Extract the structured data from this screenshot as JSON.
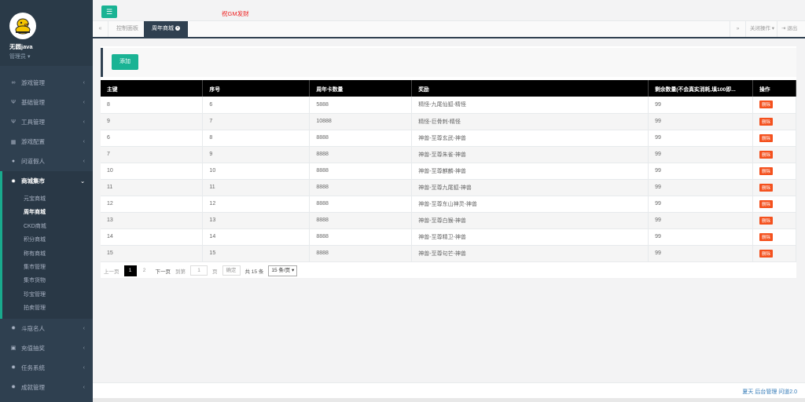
{
  "profile": {
    "name": "无圆java",
    "role": "管理员 ▾"
  },
  "sidebar": {
    "items": [
      {
        "icon": "gamepad-icon",
        "glyph": "∞",
        "label": "游戏管理"
      },
      {
        "icon": "cutlery-icon",
        "glyph": "Ψ",
        "label": "基础管理"
      },
      {
        "icon": "cutlery-icon",
        "glyph": "Ψ",
        "label": "工具管理"
      },
      {
        "icon": "table-icon",
        "glyph": "▦",
        "label": "游戏配置"
      },
      {
        "icon": "user-icon",
        "glyph": "●",
        "label": "问道假人"
      },
      {
        "icon": "gear-icon",
        "glyph": "✹",
        "label": "商城集市"
      }
    ],
    "submenu": [
      "元宝商城",
      "周年商城",
      "CKD商城",
      "积分商城",
      "称有商城",
      "集市管理",
      "集市货物",
      "珍宝管理",
      "拍卖管理"
    ],
    "items_after": [
      {
        "icon": "gear-icon",
        "glyph": "✹",
        "label": "斗寇名人"
      },
      {
        "icon": "table-icon",
        "glyph": "▣",
        "label": "充值抽奖"
      },
      {
        "icon": "gear-icon",
        "glyph": "✹",
        "label": "任务系统"
      },
      {
        "icon": "gear-icon",
        "glyph": "✹",
        "label": "成就管理"
      }
    ]
  },
  "topbar": {
    "marquee": "祝GM发财"
  },
  "tabs": {
    "items": [
      "控制面板",
      "周年商城"
    ],
    "right": {
      "close_ops": "关闭操作 ▾",
      "logout": "⇥ 退出"
    }
  },
  "toolbar": {
    "add_label": "添加"
  },
  "table": {
    "headers": [
      "主键",
      "序号",
      "周年卡数量",
      "奖励",
      "剩余数量(不会真实消耗,填100即...",
      "操作"
    ],
    "rows": [
      [
        "8",
        "6",
        "5888",
        "精怪-九尾仙狐-精怪",
        "99",
        "删除"
      ],
      [
        "9",
        "7",
        "10888",
        "精怪-巨骨刺-精怪",
        "99",
        "删除"
      ],
      [
        "6",
        "8",
        "8888",
        "神兽-至尊玄武-神兽",
        "99",
        "删除"
      ],
      [
        "7",
        "9",
        "8888",
        "神兽-至尊朱雀-神兽",
        "99",
        "删除"
      ],
      [
        "10",
        "10",
        "8888",
        "神兽-至尊麒麟-神兽",
        "99",
        "删除"
      ],
      [
        "11",
        "11",
        "8888",
        "神兽-至尊九尾狐-神兽",
        "99",
        "删除"
      ],
      [
        "12",
        "12",
        "8888",
        "神兽-至尊东山神灵-神兽",
        "99",
        "删除"
      ],
      [
        "13",
        "13",
        "8888",
        "神兽-至尊白猴-神兽",
        "99",
        "删除"
      ],
      [
        "14",
        "14",
        "8888",
        "神兽-至尊精卫-神兽",
        "99",
        "删除"
      ],
      [
        "15",
        "15",
        "8888",
        "神兽-至尊句芒-神兽",
        "99",
        "删除"
      ]
    ]
  },
  "pager": {
    "prev": "上一页",
    "page1": "1",
    "page2": "2",
    "next": "下一页",
    "goto": "到第",
    "input": "1",
    "page_unit": "页",
    "confirm": "确定",
    "total": "共 15 条",
    "per_page": "15 条/页 ▾"
  },
  "footer": {
    "text": "夏天 后台管理 问道2.0"
  }
}
